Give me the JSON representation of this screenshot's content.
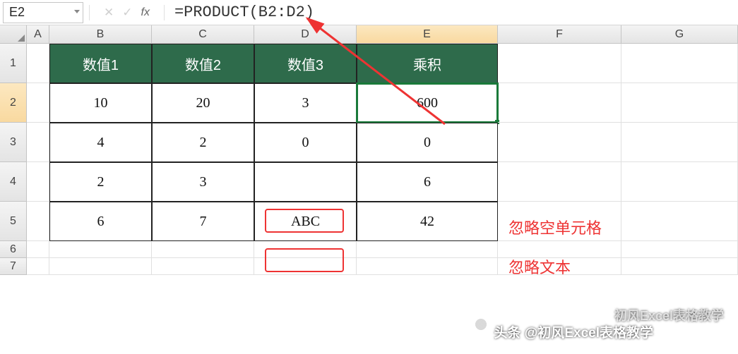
{
  "formula_bar": {
    "name_box": "E2",
    "formula": "=PRODUCT(B2:D2)"
  },
  "columns": [
    "A",
    "B",
    "C",
    "D",
    "E",
    "F",
    "G"
  ],
  "row_labels": [
    "1",
    "2",
    "3",
    "4",
    "5",
    "6",
    "7"
  ],
  "table": {
    "headers": [
      "数值1",
      "数值2",
      "数值3",
      "乘积"
    ],
    "rows": [
      {
        "v1": "10",
        "v2": "20",
        "v3": "3",
        "prod": "600"
      },
      {
        "v1": "4",
        "v2": "2",
        "v3": "0",
        "prod": "0"
      },
      {
        "v1": "2",
        "v2": "3",
        "v3": "",
        "prod": "6"
      },
      {
        "v1": "6",
        "v2": "7",
        "v3": "ABC",
        "prod": "42"
      }
    ]
  },
  "annotations": {
    "ignore_blank": "忽略空单元格",
    "ignore_text": "忽略文本"
  },
  "watermark1": "初风Excel表格教学",
  "watermark2": "头条 @初风Excel表格教学"
}
